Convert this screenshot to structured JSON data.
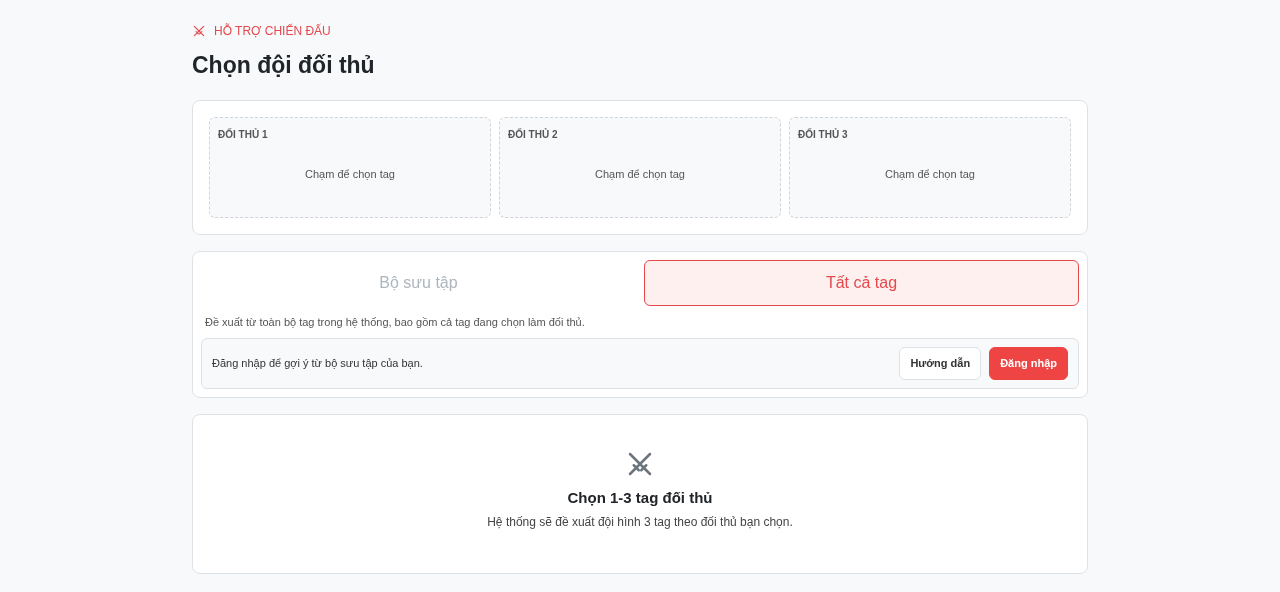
{
  "header": {
    "eyebrow": "HỖ TRỢ CHIẾN ĐẤU",
    "title": "Chọn đội đối thủ"
  },
  "slots": [
    {
      "label": "ĐỐI THỦ 1",
      "hint": "Chạm để chọn tag"
    },
    {
      "label": "ĐỐI THỦ 2",
      "hint": "Chạm để chọn tag"
    },
    {
      "label": "ĐỐI THỦ 3",
      "hint": "Chạm để chọn tag"
    }
  ],
  "tabs": [
    {
      "label": "Bộ sưu tập",
      "selected": false
    },
    {
      "label": "Tất cả tag",
      "selected": true
    }
  ],
  "description": "Đề xuất từ toàn bộ tag trong hệ thống, bao gồm cả tag đang chọn làm đối thủ.",
  "login_notice": {
    "text": "Đăng nhập để gợi ý từ bộ sưu tập của bạn.",
    "buttons": [
      {
        "label": "Hướng dẫn",
        "kind": "secondary"
      },
      {
        "label": "Đăng nhập",
        "kind": "primary"
      }
    ]
  },
  "empty_state": {
    "title": "Chọn 1-3 tag đối thủ",
    "text": "Hệ thống sẽ đề xuất đội hình 3 tag theo đối thủ bạn chọn."
  }
}
